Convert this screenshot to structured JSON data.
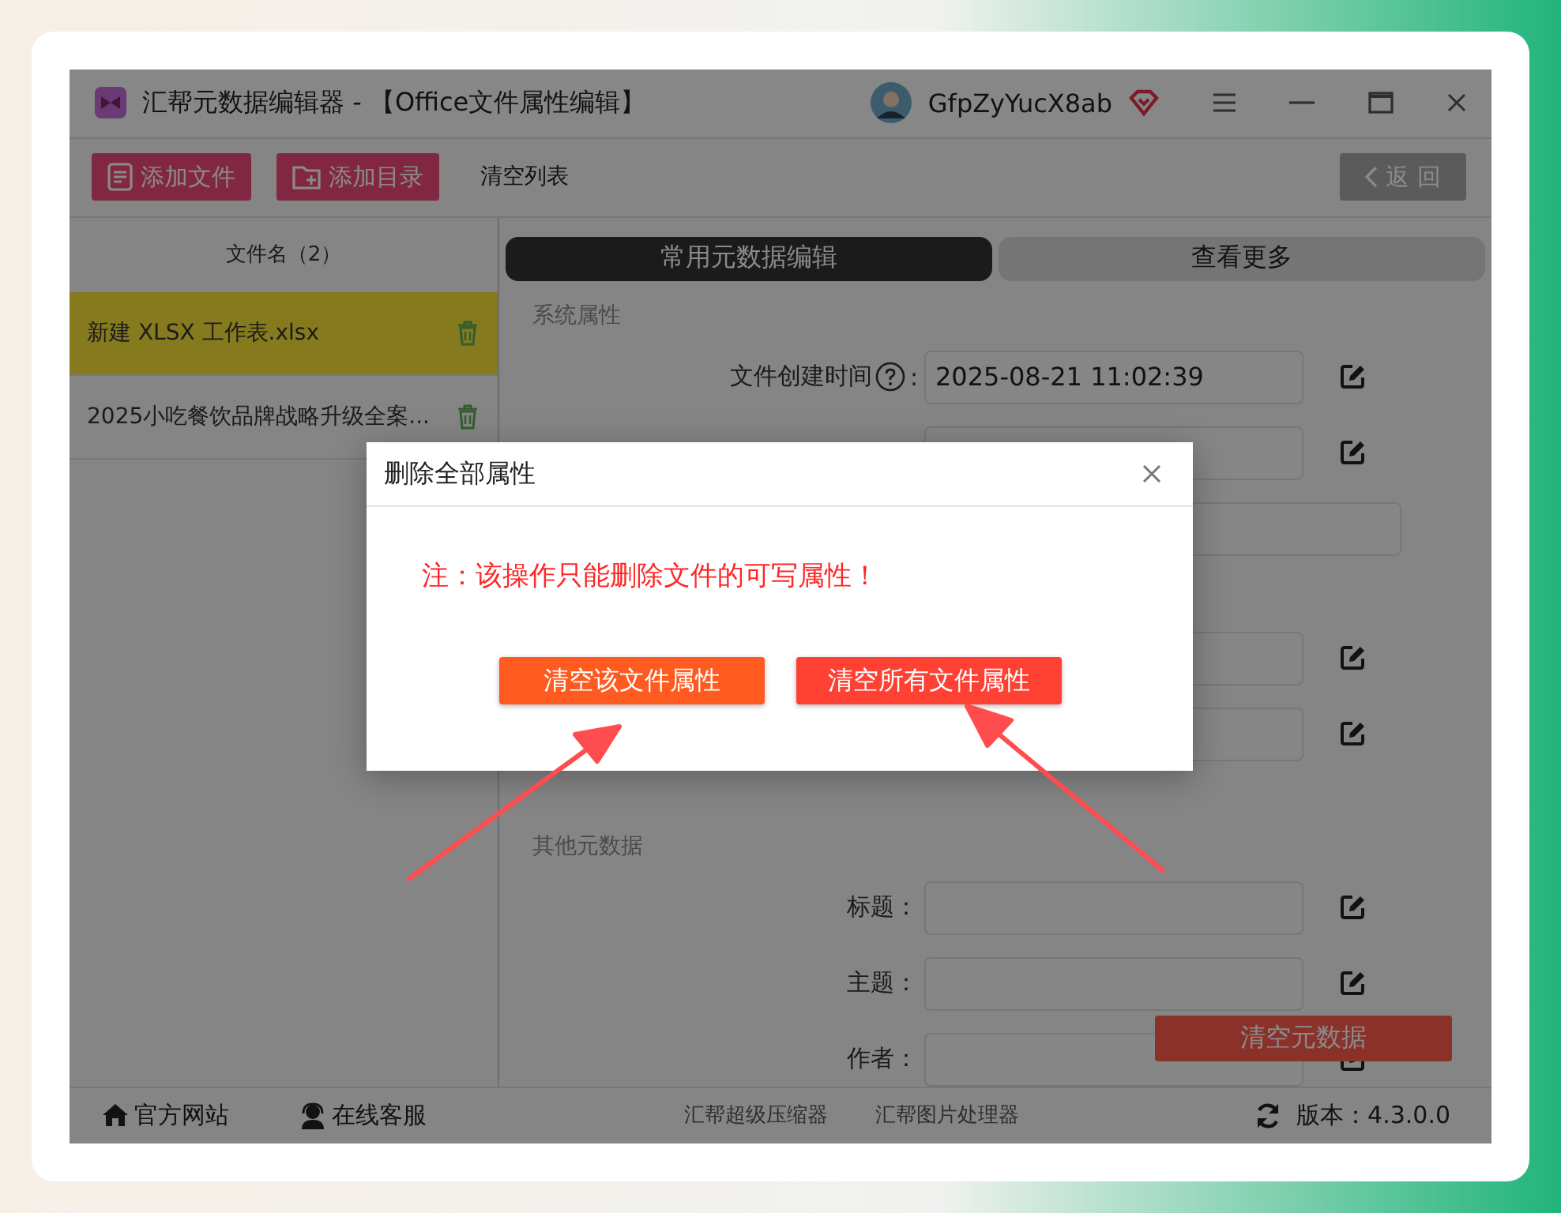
{
  "window": {
    "title": "汇帮元数据编辑器 - 【Office文件属性编辑】",
    "user": "GfpZyYucX8ab"
  },
  "toolbar": [
    {
      "label": "添加文件",
      "kind": "add-file"
    },
    {
      "label": "添加目录",
      "kind": "add-folder"
    },
    {
      "label": "清空列表",
      "kind": "text"
    },
    {
      "label": "返 回",
      "kind": "back"
    }
  ],
  "file_list": {
    "header": "文件名（2）",
    "items": [
      {
        "name": "新建 XLSX 工作表.xlsx",
        "selected": true
      },
      {
        "name": "2025小吃餐饮品牌战略升级全案...",
        "selected": false
      }
    ]
  },
  "tabs": [
    {
      "label": "常用元数据编辑",
      "selected": true
    },
    {
      "label": "查看更多",
      "selected": false
    }
  ],
  "sections": [
    {
      "title": "系统属性",
      "rows": [
        {
          "label": "文件创建时间",
          "help": true,
          "colon": ":",
          "value": "2025-08-21 11:02:39",
          "edit_button": true,
          "wide": false
        },
        {
          "help": false,
          "edit_button": true,
          "wide": false
        },
        {
          "help": false,
          "edit_button": false,
          "wide": true
        },
        {
          "help": false,
          "edit_button": true,
          "wide": false
        },
        {
          "help": false,
          "edit_button": true,
          "wide": false
        }
      ]
    },
    {
      "title": "其他元数据",
      "rows": [
        {
          "label": "标题：",
          "help": false,
          "edit_button": true,
          "wide": false
        },
        {
          "label": "主题：",
          "help": false,
          "edit_button": true,
          "wide": false
        },
        {
          "label": "作者：",
          "help": false,
          "edit_button": true,
          "wide": false
        }
      ]
    }
  ],
  "clear_button": "清空元数据",
  "footer": {
    "links": [
      {
        "label": "官方网站",
        "kind": "home"
      },
      {
        "label": "在线客服",
        "kind": "service"
      },
      {
        "label": "汇帮超级压缩器",
        "kind": "plain"
      },
      {
        "label": "汇帮图片处理器",
        "kind": "plain"
      }
    ],
    "version": "版本：4.3.0.0"
  },
  "dialog": {
    "modal": true,
    "title": "删除全部属性",
    "message": "注：该操作只能删除文件的可写属性！",
    "buttons": [
      {
        "label": "清空该文件属性",
        "kind": "orange"
      },
      {
        "label": "清空所有文件属性",
        "kind": "red"
      }
    ]
  }
}
